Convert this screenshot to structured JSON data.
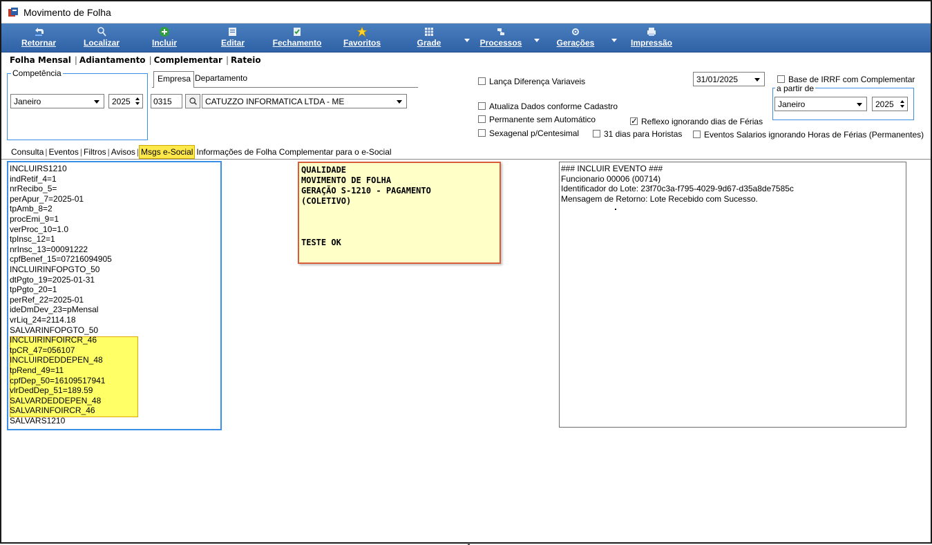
{
  "window": {
    "title": "Movimento de Folha"
  },
  "toolbar": {
    "buttons": [
      {
        "label": "Retornar",
        "icon": "return-icon"
      },
      {
        "label": "Localizar",
        "icon": "search-icon"
      },
      {
        "label": "Incluir",
        "icon": "add-icon"
      },
      {
        "label": "Editar",
        "icon": "edit-icon"
      },
      {
        "label": "Fechamento",
        "icon": "close-document-icon"
      },
      {
        "label": "Favoritos",
        "icon": "star-icon"
      },
      {
        "label": "Grade",
        "icon": "grid-icon"
      },
      {
        "label": "Processos",
        "icon": "process-icon"
      },
      {
        "label": "Gerações",
        "icon": "gear-icon"
      },
      {
        "label": "Impressão",
        "icon": "printer-icon"
      }
    ]
  },
  "main_tabs": [
    "Folha Mensal",
    "Adiantamento",
    "Complementar",
    "Rateio"
  ],
  "competencia": {
    "legend": "Competência",
    "month": "Janeiro",
    "year": "2025"
  },
  "empresa_tabs": [
    "Empresa",
    "Departamento"
  ],
  "empresa": {
    "code": "0315",
    "name": "CATUZZO INFORMATICA LTDA - ME"
  },
  "options": {
    "lanca_diferenca": "Lança Diferença Variaveis",
    "atualiza_dados": "Atualiza Dados conforme Cadastro",
    "permanente": "Permanente sem Automático",
    "sexagenal": "Sexagenal p/Centesimal",
    "reflexo": "Reflexo ignorando dias de Férias",
    "dias31": "31 dias para Horistas",
    "eventos_salarios": "Eventos Salarios ignorando Horas de Férias (Permanentes)",
    "date": "31/01/2025",
    "base_irrf": "Base de IRRF com Complementar",
    "a_partir_legend": "a partir de",
    "a_partir_month": "Janeiro",
    "a_partir_year": "2025"
  },
  "sub_tabs": [
    "Consulta",
    "Eventos",
    "Filtros",
    "Avisos",
    "Msgs e-Social",
    "Informações de Folha Complementar para o e-Social"
  ],
  "msgs_list": [
    "INCLUIRS1210",
    "indRetif_4=1",
    "nrRecibo_5=",
    "perApur_7=2025-01",
    "tpAmb_8=2",
    "procEmi_9=1",
    "verProc_10=1.0",
    "tpInsc_12=1",
    "nrInsc_13=00091222",
    "cpfBenef_15=07216094905",
    "INCLUIRINFOPGTO_50",
    "dtPgto_19=2025-01-31",
    "tpPgto_20=1",
    "perRef_22=2025-01",
    "ideDmDev_23=pMensal",
    "vrLiq_24=2114.18",
    "SALVARINFOPGTO_50",
    "INCLUIRINFOIRCR_46",
    "tpCR_47=056107",
    "INCLUIRDEDDEPEN_48",
    "tpRend_49=11",
    "cpfDep_50=16109517941",
    "vlrDedDep_51=189.59",
    "SALVARDEDDEPEN_48",
    "SALVARINFOIRCR_46",
    "SALVARS1210"
  ],
  "note": {
    "lines": [
      "QUALIDADE",
      "MOVIMENTO DE FOLHA",
      "GERAÇÃO S-1210 - PAGAMENTO",
      "(COLETIVO)",
      "",
      "",
      "",
      "TESTE OK"
    ]
  },
  "return_memo": {
    "lines": [
      "### INCLUIR EVENTO ###",
      "Funcionario 00006 (00714)",
      "Identificador do Lote: 23f70c3a-f795-4029-9d67-d35a8de7585c",
      "Mensagem de Retorno: Lote Recebido com Sucesso."
    ]
  },
  "colors": {
    "toolbar": "#3a6fb3",
    "highlight": "#ffff66",
    "note_border": "#d95c3a",
    "focus_border": "#3a8ee6"
  }
}
